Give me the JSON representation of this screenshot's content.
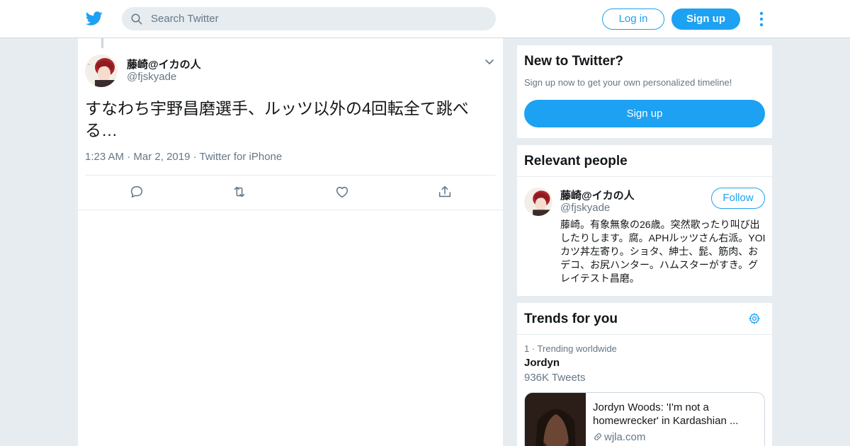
{
  "header": {
    "search_placeholder": "Search Twitter",
    "login_label": "Log in",
    "signup_label": "Sign up"
  },
  "tweet": {
    "author_name": "藤崎@イカの人",
    "author_handle": "@fjskyade",
    "text": "すなわち宇野昌磨選手、ルッツ以外の4回転全て跳べる…",
    "time": "1:23 AM",
    "date": "Mar 2, 2019",
    "source": "Twitter for iPhone",
    "separator": " · "
  },
  "new_to_twitter": {
    "title": "New to Twitter?",
    "subtitle": "Sign up now to get your own personalized timeline!",
    "button_label": "Sign up"
  },
  "relevant_people": {
    "title": "Relevant people",
    "name": "藤崎@イカの人",
    "handle": "@fjskyade",
    "follow_label": "Follow",
    "bio": "藤崎。有象無象の26歳。突然歌ったり叫び出したりします。腐。APHルッツさん右派。YOIカツ丼左寄り。ショタ、紳士、髭、筋肉、おデコ、お尻ハンター。ハムスターがすき。グレイテスト昌磨。"
  },
  "trends": {
    "title": "Trends for you",
    "meta": "1 · Trending worldwide",
    "trend_name": "Jordyn",
    "tweet_count": "936K Tweets",
    "card_title": "Jordyn Woods: 'I'm not a homewrecker' in Kardashian ...",
    "card_domain": "wjla.com"
  },
  "colors": {
    "accent": "#1da1f2",
    "background": "#e6ecf0",
    "secondary_text": "#657786"
  },
  "icons": [
    "twitter-logo-icon",
    "search-icon",
    "more-vertical-icon",
    "chevron-down-icon",
    "reply-icon",
    "retweet-icon",
    "like-icon",
    "share-icon",
    "gear-icon",
    "link-icon"
  ]
}
